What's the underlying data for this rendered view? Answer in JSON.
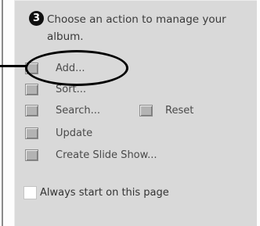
{
  "step_number": "3",
  "heading": "Choose an action to manage your album.",
  "actions": [
    {
      "label": "Add..."
    },
    {
      "label": "Sort..."
    },
    {
      "label": "Search..."
    },
    {
      "label": "Update"
    },
    {
      "label": "Create Slide Show..."
    }
  ],
  "reset": {
    "label": "Reset"
  },
  "always_start": {
    "label": "Always start on this page",
    "checked": false
  }
}
